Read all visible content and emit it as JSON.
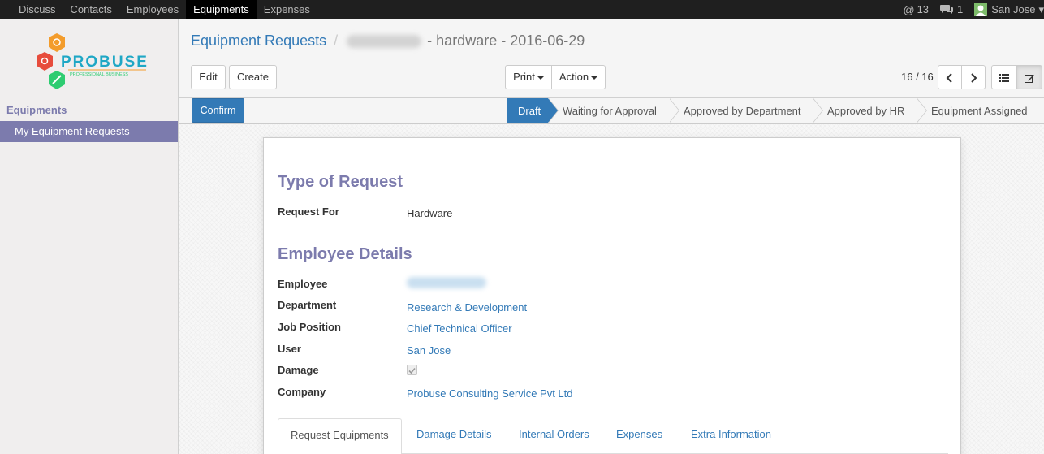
{
  "topnav": {
    "items": [
      "Discuss",
      "Contacts",
      "Employees",
      "Equipments",
      "Expenses"
    ],
    "active_index": 3,
    "mentions_count": "13",
    "messages_count": "1",
    "user_name": "San Jose"
  },
  "sidebar": {
    "logo": {
      "brand": "PROBUSE",
      "tagline": "PROFESSIONAL BUSINESS"
    },
    "heading": "Equipments",
    "item": "My Equipment Requests"
  },
  "breadcrumb": {
    "parent": "Equipment Requests",
    "separator": "/",
    "current": "- hardware - 2016-06-29"
  },
  "toolbar": {
    "edit": "Edit",
    "create": "Create",
    "print": "Print",
    "action": "Action"
  },
  "pager": {
    "value": "16 / 16"
  },
  "statusbar": {
    "confirm": "Confirm",
    "stages": [
      "Draft",
      "Waiting for Approval",
      "Approved by Department",
      "Approved by HR",
      "Equipment Assigned"
    ],
    "active_stage": "Draft"
  },
  "form": {
    "type_section": "Type of Request",
    "request_for_label": "Request For",
    "request_for_value": "Hardware",
    "employee_section": "Employee Details",
    "employee_label": "Employee",
    "department_label": "Department",
    "department_value": "Research & Development",
    "job_label": "Job Position",
    "job_value": "Chief Technical Officer",
    "user_label": "User",
    "user_value": "San Jose",
    "damage_label": "Damage",
    "damage_checked": true,
    "company_label": "Company",
    "company_value": "Probuse Consulting Service Pvt Ltd"
  },
  "tabs": [
    "Request Equipments",
    "Damage Details",
    "Internal Orders",
    "Expenses",
    "Extra Information"
  ],
  "colors": {
    "accent": "#7c7bad",
    "primary": "#337ab7",
    "topbar": "#1f1f1f"
  }
}
